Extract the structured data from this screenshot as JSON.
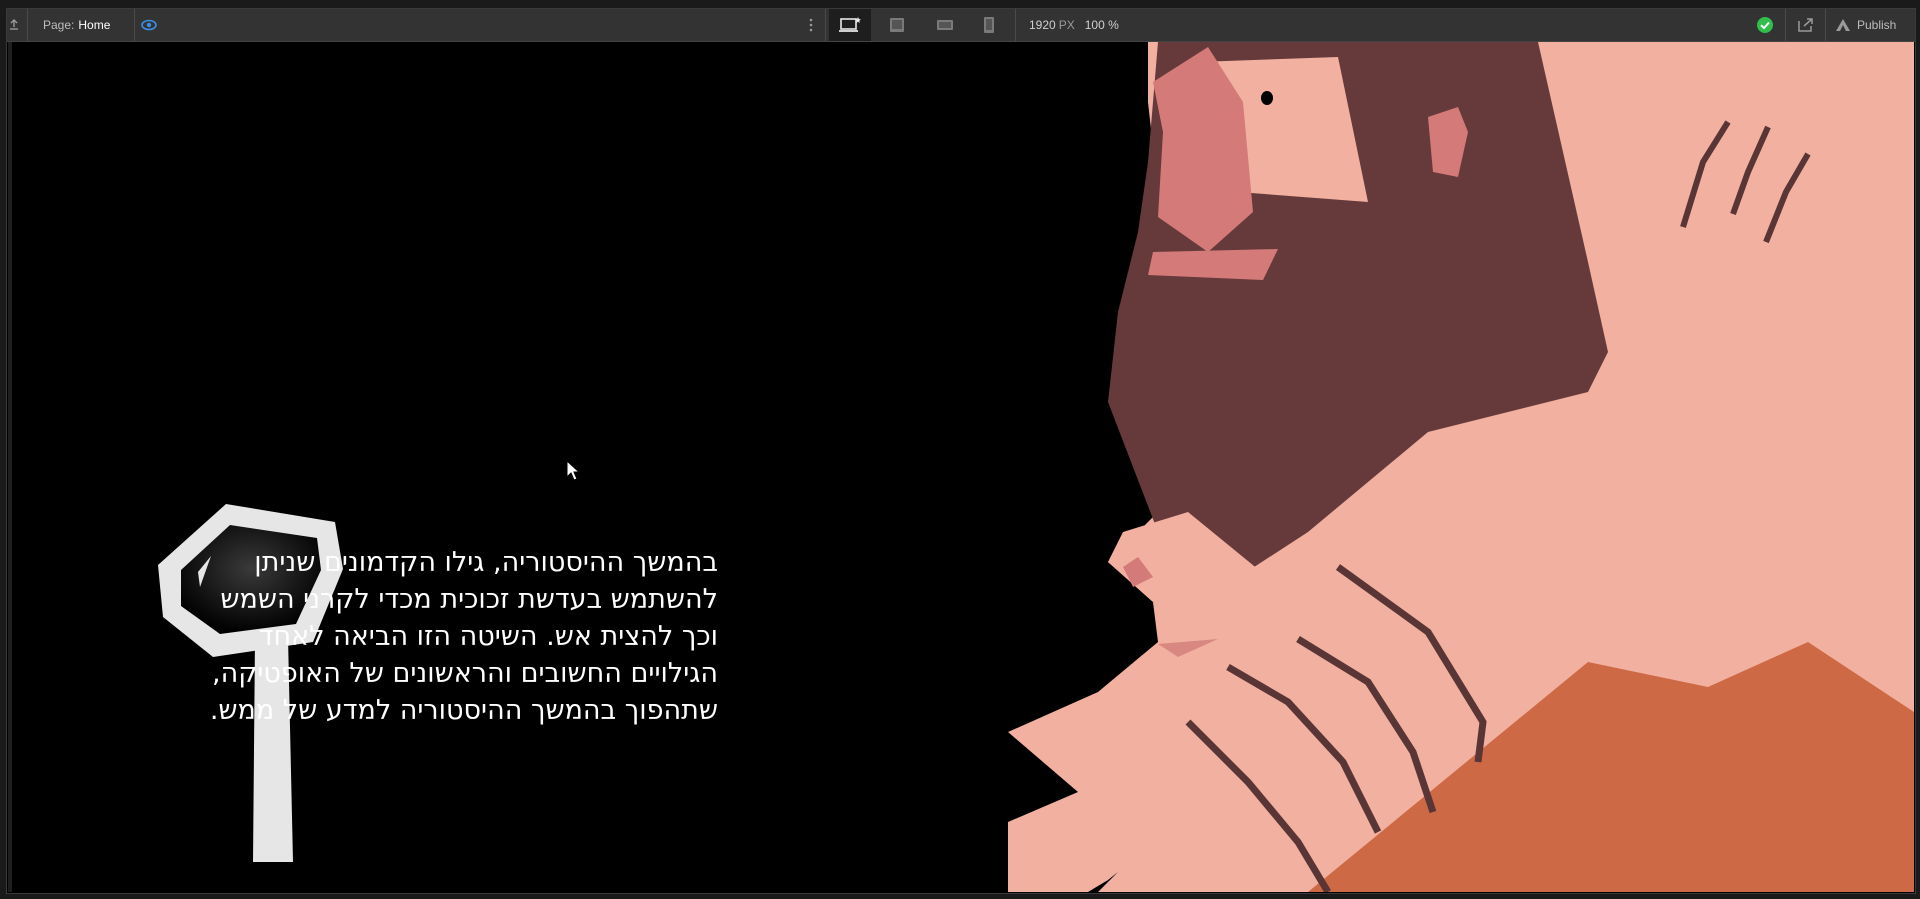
{
  "toolbar": {
    "page_label": "Page:",
    "page_name": "Home",
    "width_value": "1920",
    "width_unit": "PX",
    "zoom": "100 %",
    "publish_label": "Publish"
  },
  "icons": {
    "collapse": "panel-collapse-icon",
    "preview": "eye-icon",
    "more": "more-vertical-icon",
    "desktop": "desktop-icon",
    "tablet_landscape": "tablet-landscape-icon",
    "mobile_landscape": "mobile-landscape-icon",
    "mobile_portrait": "mobile-portrait-icon",
    "status": "check-circle-icon",
    "export": "export-icon",
    "publish": "publish-icon"
  },
  "content": {
    "paragraph_lines": [
      "בהמשך ההיסטוריה, גילו הקדמונים שניתן",
      "להשתמש בעדשת זכוכית מכדי לקרני השמש",
      "וכך להצית אש. השיטה הזו הביאה לאחד",
      "הגילויים החשובים והראשונים של האופטיקה,",
      "שתהפוך בהמשך ההיסטוריה למדע של ממש."
    ]
  },
  "colors": {
    "accent_blue": "#3a8ee6",
    "status_green": "#2fbf4a",
    "skin": "#f2b0a0",
    "beard": "#663a3a",
    "nose": "#d47a78",
    "robe": "#cd6a45",
    "lines": "#5a3535"
  }
}
